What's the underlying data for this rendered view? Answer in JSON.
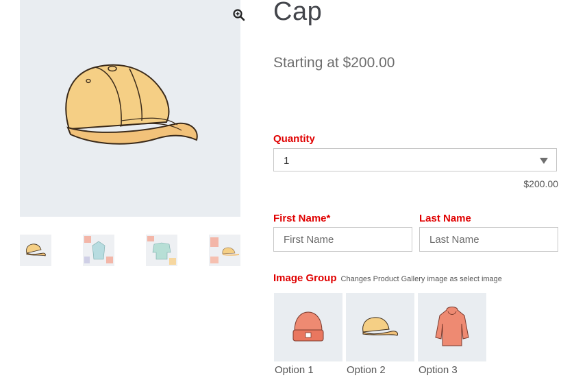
{
  "product": {
    "title": "Cap",
    "price_text": "Starting at $200.00",
    "main_image_icon": "cap-illustration",
    "zoom_icon": "magnifier-plus-icon",
    "thumbnails": [
      "cap-thumbnail",
      "patterned-hoodie-thumbnail",
      "patterned-sweater-thumbnail",
      "patterned-cap-thumbnail"
    ]
  },
  "quantity": {
    "label": "Quantity",
    "selected": "1",
    "subtotal": "$200.00"
  },
  "first_name": {
    "label": "First Name*",
    "placeholder": "First Name"
  },
  "last_name": {
    "label": "Last Name",
    "placeholder": "Last Name"
  },
  "image_group": {
    "label": "Image Group",
    "hint": "Changes Product Gallery image as select image",
    "options": [
      {
        "label": "Option 1",
        "icon": "beanie-icon"
      },
      {
        "label": "Option 2",
        "icon": "cap-icon"
      },
      {
        "label": "Option 3",
        "icon": "hoodie-icon"
      }
    ]
  },
  "colors": {
    "label_red": "#e00000",
    "image_bg": "#e9edf1",
    "cap_yellow": "#f5cf85",
    "salmon": "#ee8a72"
  }
}
